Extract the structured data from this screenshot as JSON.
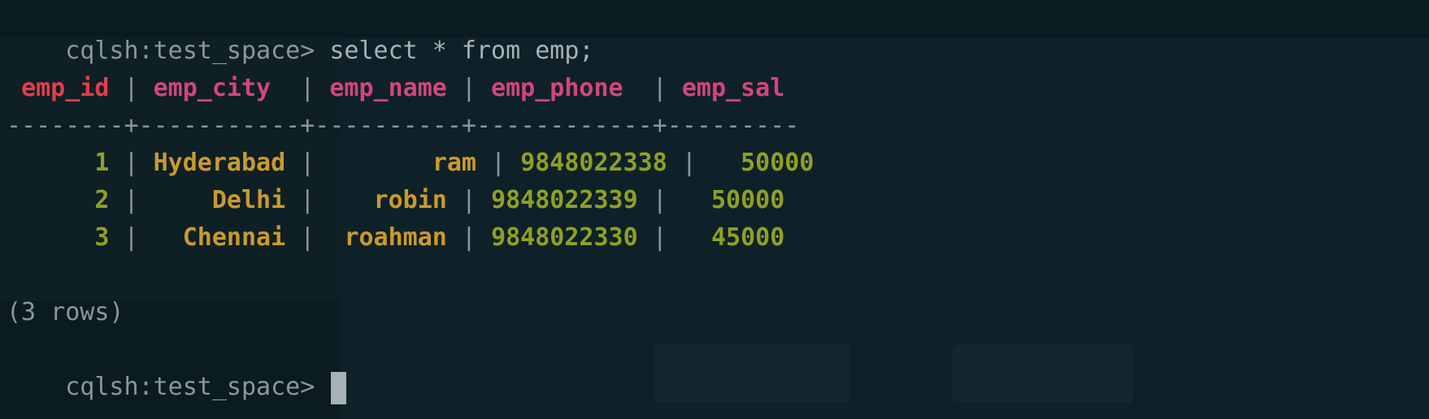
{
  "terminal": {
    "prompt": "cqlsh:test_space> ",
    "command": "select * from emp;",
    "columns": [
      "emp_id",
      "emp_city",
      "emp_name",
      "emp_phone",
      "emp_sal"
    ],
    "divider": "--------+-----------+----------+------------+---------",
    "rows": [
      {
        "emp_id": "1",
        "emp_city": "Hyderabad",
        "emp_name": "ram",
        "emp_phone": "9848022338",
        "emp_sal": "50000"
      },
      {
        "emp_id": "2",
        "emp_city": "Delhi",
        "emp_name": "robin",
        "emp_phone": "9848022339",
        "emp_sal": "50000"
      },
      {
        "emp_id": "3",
        "emp_city": "Chennai",
        "emp_name": "roahman",
        "emp_phone": "9848022330",
        "emp_sal": "45000"
      }
    ],
    "row_count": "(3 rows)",
    "prompt_after": "cqlsh:test_space> "
  },
  "colors": {
    "background": "#0b1b22",
    "header": "#d2457e",
    "header_id": "#df3f4b",
    "number": "#8fa025",
    "string": "#c99a2e",
    "text": "#a7b2b6"
  }
}
